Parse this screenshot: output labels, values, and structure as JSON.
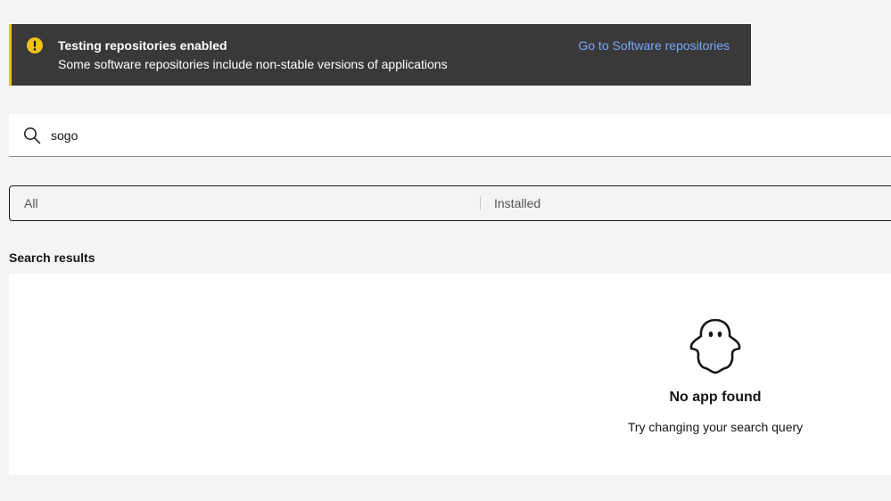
{
  "banner": {
    "title": "Testing repositories enabled",
    "subtitle": "Some software repositories include non-stable versions of applications",
    "link": "Go to Software repositories",
    "icon": "warning-icon",
    "accent_color": "#f1c21b",
    "link_color": "#78a9ff"
  },
  "search": {
    "value": "sogo",
    "icon": "search-icon"
  },
  "switcher": {
    "tabs": [
      {
        "label": "All"
      },
      {
        "label": "Installed"
      }
    ]
  },
  "results": {
    "heading": "Search results",
    "empty_icon": "ghost-icon",
    "empty_title": "No app found",
    "empty_subtitle": "Try changing your search query"
  }
}
